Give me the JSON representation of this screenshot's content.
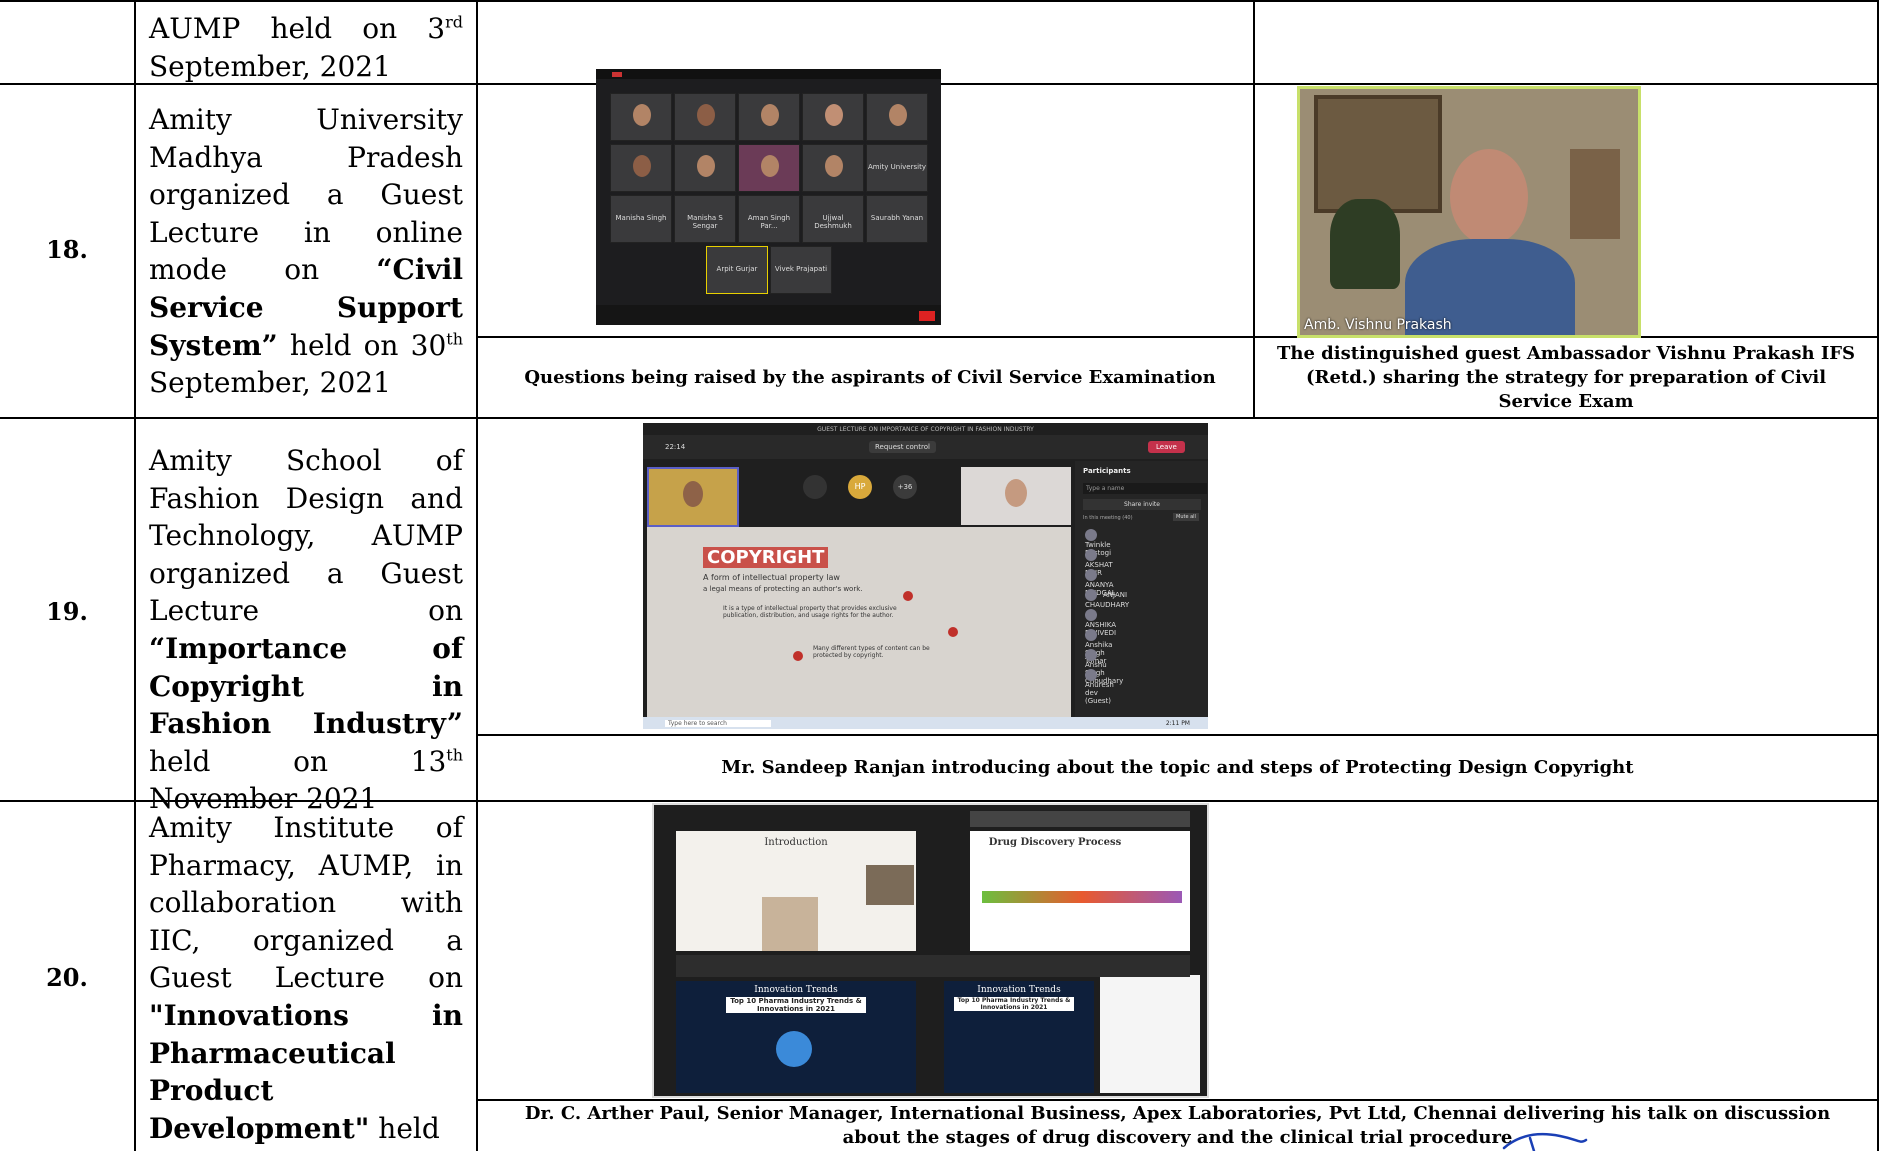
{
  "rows": [
    {
      "number": "",
      "desc_parts": [
        {
          "t": "AUMP held on 3"
        },
        {
          "t": "rd",
          "sup": true
        },
        {
          "t": " September, 2021"
        }
      ]
    },
    {
      "number": "18.",
      "desc_parts": [
        {
          "t": "Amity University Madhya Pradesh organized a Guest Lecture in online mode on "
        },
        {
          "t": "“Civil Service Support System”",
          "bold": true
        },
        {
          "t": " held on 30"
        },
        {
          "t": "th",
          "sup": true
        },
        {
          "t": " September, 2021"
        }
      ],
      "caption_left": "Questions being raised by the aspirants of Civil Service Examination",
      "caption_right": "The distinguished guest Ambassador Vishnu Prakash IFS (Retd.) sharing the strategy for preparation of Civil Service Exam",
      "photo_right_label": "Amb. Vishnu Prakash"
    },
    {
      "number": "19.",
      "desc_parts": [
        {
          "t": "Amity School of Fashion Design and Technology, AUMP organized a Guest Lecture on "
        },
        {
          "t": "“Importance of Copyright in Fashion Industry”",
          "bold": true
        },
        {
          "t": " held on 13"
        },
        {
          "t": "th",
          "sup": true
        },
        {
          "t": " November 2021"
        }
      ],
      "caption": "Mr. Sandeep Ranjan introducing about the topic and steps of Protecting Design Copyright",
      "screenshot": {
        "title_bar": "GUEST LECTURE ON IMPORTANCE OF COPYRIGHT IN FASHION INDUSTRY",
        "timer": "22:14",
        "request_control": "Request control",
        "leave": "Leave",
        "avatar_initials": "HP",
        "avatar_more": "+36",
        "slide_heading": "COPYRIGHT",
        "slide_sub": "A form of intellectual property law",
        "slide_line1": "a legal means of protecting an author's work.",
        "slide_line2": "It is a type of intellectual property that provides exclusive publication, distribution, and usage rights for the author.",
        "slide_line3": "Many different types of content can be protected by copyright.",
        "participants_title": "Participants",
        "search_placeholder": "Type a name",
        "share_invite": "Share invite",
        "in_meeting": "In this meeting (40)",
        "mute_all": "Mute all",
        "participants": [
          "Twinkle Rastogi",
          "AKSHAT NAIR",
          "ANANYA MUDGAL",
          "ANJANI CHAUDHARY",
          "ANSHIKA DWIVEDI",
          "Anshika Singh Tomar",
          "Anshu Singh Choudhary",
          "Anuresh dev (Guest)"
        ],
        "taskbar_search": "Type here to search",
        "clock": "2:11 PM"
      }
    },
    {
      "number": "20.",
      "desc_parts": [
        {
          "t": "Amity Institute of Pharmacy, AUMP, in collaboration with IIC, organized a Guest Lecture on "
        },
        {
          "t": "\"Innovations in Pharmaceutical Product Development\"",
          "bold": true
        },
        {
          "t": " held"
        }
      ],
      "caption": "Dr. C. Arther Paul, Senior Manager, International Business, Apex Laboratories, Pvt Ltd, Chennai delivering his talk on discussion about the stages of drug discovery and the clinical trial procedure",
      "slides": {
        "intro": "Introduction",
        "drug_discovery": "Drug Discovery Process",
        "innovation": "Innovation Trends",
        "top10": "Top 10 Pharma Industry Trends & Innovations in 2021"
      }
    }
  ],
  "zoom_grid_names": [
    "Manisha Singh",
    "Manisha S Sengar",
    "Aman Singh Par...",
    "Ujjwal Deshmukh",
    "Saurabh Yanan",
    "Arpit Gurjar",
    "Vivek Prajapati",
    "Amity University"
  ]
}
